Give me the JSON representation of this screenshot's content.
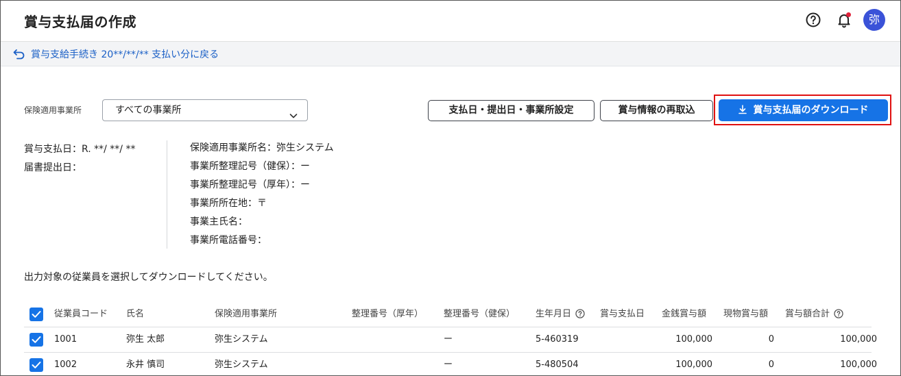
{
  "header": {
    "title": "賞与支払届の作成",
    "avatar_text": "弥",
    "icons": [
      "help-circle-icon",
      "bell-icon"
    ],
    "notification_dot_color": "#e0213a",
    "avatar_color": "#3a52d8"
  },
  "back_link": {
    "label": "賞与支給手続き 20**/**/** 支払い分に戻る",
    "icon": "return-arrow-icon"
  },
  "filter": {
    "label": "保険適用事業所",
    "selected": "すべての事業所"
  },
  "actions": {
    "settings_label": "支払日・提出日・事業所設定",
    "reimport_label": "賞与情報の再取込",
    "download_label": "賞与支払届のダウンロード",
    "download_color": "#1673e6",
    "highlight_color": "#e01010"
  },
  "info": {
    "left": {
      "pay_date": "賞与支払日：R. **/ **/ **",
      "submit_date": "届書提出日："
    },
    "right": {
      "office_name": "保険適用事業所名：弥生システム",
      "ref_health": "事業所整理記号（健保）：ー",
      "ref_pension": "事業所整理記号（厚年）：ー",
      "address": "事業所所在地：〒",
      "owner": "事業主氏名：",
      "phone": "事業所電話番号："
    }
  },
  "instruction": "出力対象の従業員を選択してダウンロードしてください。",
  "table": {
    "columns": [
      "従業員コード",
      "氏名",
      "保険適用事業所",
      "整理番号（厚年）",
      "整理番号（健保）",
      "生年月日",
      "賞与支払日",
      "金銭賞与額",
      "現物賞与額",
      "賞与額合計"
    ],
    "rows": [
      {
        "checked": true,
        "code": "1001",
        "name": "弥生 太郎",
        "office": "弥生システム",
        "ref_pension": "",
        "ref_health": "ー",
        "birth": "5-460319",
        "pay_date": "",
        "cash": "100,000",
        "inkind": "0",
        "total": "100,000"
      },
      {
        "checked": true,
        "code": "1002",
        "name": "永井 慎司",
        "office": "弥生システム",
        "ref_pension": "",
        "ref_health": "ー",
        "birth": "5-480504",
        "pay_date": "",
        "cash": "100,000",
        "inkind": "0",
        "total": "100,000"
      }
    ]
  }
}
